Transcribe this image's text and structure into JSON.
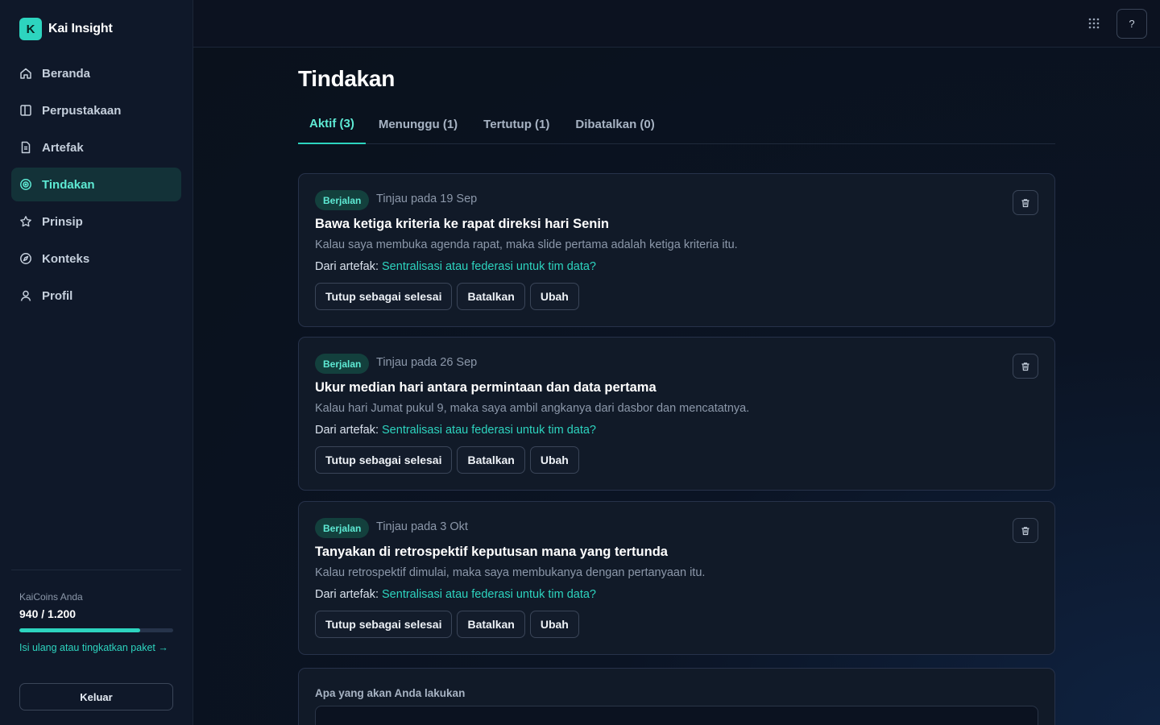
{
  "brand": {
    "logo_letter": "K",
    "name": "Kai Insight"
  },
  "sidebar": {
    "items": [
      {
        "label": "Beranda",
        "icon": "home-icon",
        "active": false
      },
      {
        "label": "Perpustakaan",
        "icon": "library-icon",
        "active": false
      },
      {
        "label": "Artefak",
        "icon": "document-icon",
        "active": false
      },
      {
        "label": "Tindakan",
        "icon": "target-icon",
        "active": true
      },
      {
        "label": "Prinsip",
        "icon": "star-icon",
        "active": false
      },
      {
        "label": "Konteks",
        "icon": "compass-icon",
        "active": false
      },
      {
        "label": "Profil",
        "icon": "user-icon",
        "active": false
      }
    ],
    "coins": {
      "label": "KaiCoins Anda",
      "value": "940 / 1.200",
      "progress": 0.783,
      "link": "Isi ulang atau tingkatkan paket →"
    },
    "logout": "Keluar"
  },
  "topbar": {
    "apps_icon": "grid-icon",
    "help_label": "?"
  },
  "page": {
    "title": "Tindakan",
    "tabs": [
      {
        "label": "Aktif (3)",
        "active": true
      },
      {
        "label": "Menunggu (1)",
        "active": false
      },
      {
        "label": "Tertutup (1)",
        "active": false
      },
      {
        "label": "Dibatalkan (0)",
        "active": false
      }
    ],
    "actions": [
      {
        "status": "Berjalan",
        "review": "Tinjau pada 19 Sep",
        "title": "Bawa ketiga kriteria ke rapat direksi hari Senin",
        "description": "Kalau saya membuka agenda rapat, maka slide pertama adalah ketiga kriteria itu.",
        "source_prefix": "Dari artefak:",
        "source_link": "Sentralisasi atau federasi untuk tim data?",
        "buttons": {
          "close": "Tutup sebagai selesai",
          "cancel": "Batalkan",
          "edit": "Ubah"
        }
      },
      {
        "status": "Berjalan",
        "review": "Tinjau pada 26 Sep",
        "title": "Ukur median hari antara permintaan dan data pertama",
        "description": "Kalau hari Jumat pukul 9, maka saya ambil angkanya dari dasbor dan mencatatnya.",
        "source_prefix": "Dari artefak:",
        "source_link": "Sentralisasi atau federasi untuk tim data?",
        "buttons": {
          "close": "Tutup sebagai selesai",
          "cancel": "Batalkan",
          "edit": "Ubah"
        }
      },
      {
        "status": "Berjalan",
        "review": "Tinjau pada 3 Okt",
        "title": "Tanyakan di retrospektif keputusan mana yang tertunda",
        "description": "Kalau retrospektif dimulai, maka saya membukanya dengan pertanyaan itu.",
        "source_prefix": "Dari artefak:",
        "source_link": "Sentralisasi atau federasi untuk tim data?",
        "buttons": {
          "close": "Tutup sebagai selesai",
          "cancel": "Batalkan",
          "edit": "Ubah"
        }
      }
    ],
    "new_action": {
      "label": "Apa yang akan Anda lakukan",
      "value": ""
    }
  },
  "colors": {
    "accent": "#2dd4bf",
    "background": "#0c1220",
    "sidebar": "#0f1829",
    "card": "#111a28"
  }
}
